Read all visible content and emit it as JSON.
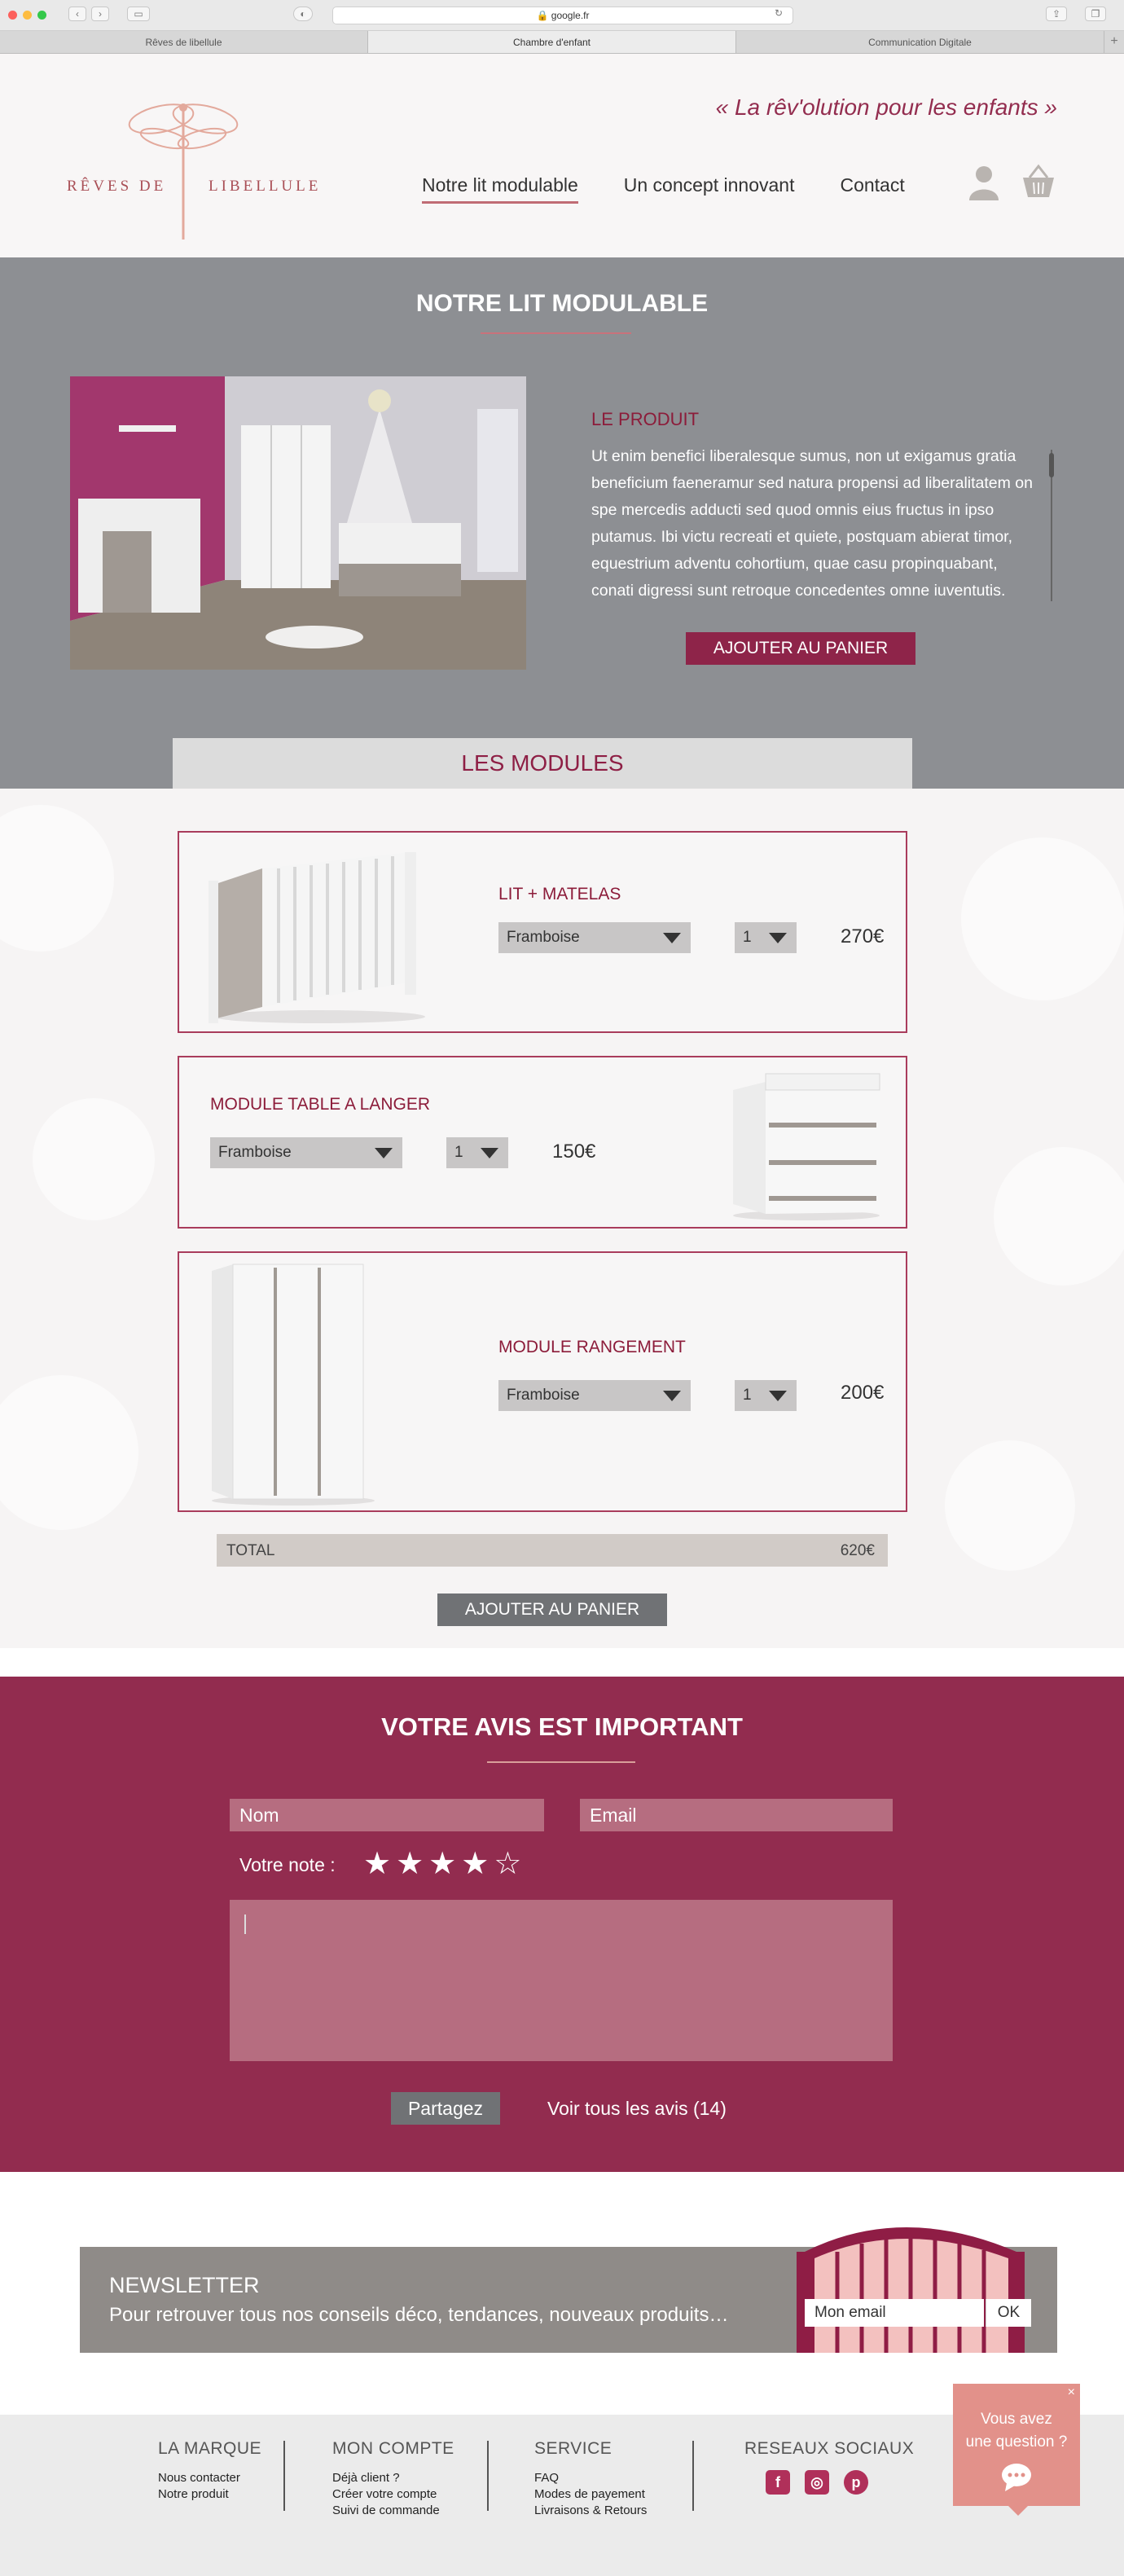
{
  "browser": {
    "url": "google.fr",
    "tabs": [
      "Rêves de libellule",
      "Chambre d'enfant",
      "Communication Digitale"
    ],
    "tab_add": "+"
  },
  "header": {
    "brand_left": "RÊVES DE",
    "brand_right": "LIBELLULE",
    "tagline": "« La rêv'olution pour les enfants »",
    "nav": [
      "Notre lit modulable",
      "Un concept innovant",
      "Contact"
    ]
  },
  "hero": {
    "title": "NOTRE LIT MODULABLE",
    "product_label": "LE PRODUIT",
    "product_text": "Ut enim benefici liberalesque sumus, non ut exigamus gratia beneficium faeneramur sed natura propensi ad liberalitatem on spe mercedis adducti sed quod omnis eius fructus in ipso putamus. Ibi victu recreati et quiete, postquam abierat timor, equestrium adventu cohortium, quae casu propinquabant, conati digressi sunt retroque concedentes omne iuventutis.",
    "cart_button": "AJOUTER AU PANIER"
  },
  "modules": {
    "tab_title": "LES MODULES",
    "items": [
      {
        "title": "LIT + MATELAS",
        "color": "Framboise",
        "qty": "1",
        "price": "270€"
      },
      {
        "title": "MODULE TABLE A LANGER",
        "color": "Framboise",
        "qty": "1",
        "price": "150€"
      },
      {
        "title": "MODULE RANGEMENT",
        "color": "Framboise",
        "qty": "1",
        "price": "200€"
      }
    ],
    "total_label": "TOTAL",
    "total_value": "620€",
    "cart_button": "AJOUTER AU PANIER"
  },
  "reviews": {
    "title": "VOTRE AVIS EST IMPORTANT",
    "name_placeholder": "Nom",
    "email_placeholder": "Email",
    "rating_label": "Votre note :",
    "rating": 4,
    "rating_max": 5,
    "share_button": "Partagez",
    "see_all": "Voir tous les avis (14)"
  },
  "newsletter": {
    "title": "NEWSLETTER",
    "text": "Pour retrouver tous nos conseils déco, tendances, nouveaux produits…",
    "email_placeholder": "Mon email",
    "ok_button": "OK"
  },
  "footer": {
    "brand": {
      "heading": "LA MARQUE",
      "links": [
        "Nous contacter",
        "Notre produit"
      ]
    },
    "account": {
      "heading": "MON COMPTE",
      "links": [
        "Déjà client ?",
        "Créer votre compte",
        "Suivi de commande"
      ]
    },
    "service": {
      "heading": "SERVICE",
      "links": [
        "FAQ",
        "Modes de payement",
        "Livraisons & Retours"
      ]
    },
    "social": {
      "heading": "RESEAUX SOCIAUX",
      "icons": [
        "facebook-icon",
        "instagram-icon",
        "pinterest-icon"
      ]
    }
  },
  "chat": {
    "close": "×",
    "line1": "Vous avez",
    "line2": "une question ?"
  },
  "colors": {
    "brand_raspberry": "#922c4f",
    "accent_pink": "#c06c74",
    "grey_section": "#8d8f93",
    "chat_pink": "#e2918a"
  }
}
